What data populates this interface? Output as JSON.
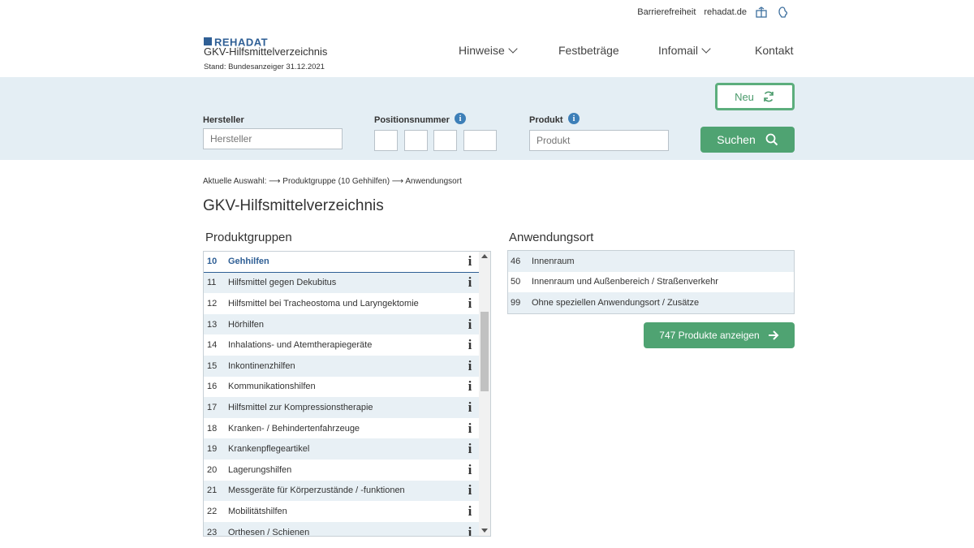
{
  "utility": {
    "accessibility": "Barrierefreiheit",
    "site": "rehadat.de",
    "icon1": "sign-language-icon",
    "icon2": "easy-language-icon"
  },
  "logo": {
    "brand": "REHADAT",
    "title": "GKV-Hilfsmittelverzeichnis",
    "stand": "Stand: Bundesanzeiger 31.12.2021"
  },
  "nav": [
    {
      "label": "Hinweise",
      "dropdown": true
    },
    {
      "label": "Festbeträge",
      "dropdown": false
    },
    {
      "label": "Infomail",
      "dropdown": true
    },
    {
      "label": "Kontakt",
      "dropdown": false
    }
  ],
  "search": {
    "hersteller_label": "Hersteller",
    "hersteller_placeholder": "Hersteller",
    "position_label": "Positionsnummer",
    "produkt_label": "Produkt",
    "produkt_placeholder": "Produkt",
    "neu_label": "Neu",
    "suchen_label": "Suchen"
  },
  "breadcrumb": "Aktuelle Auswahl: ⟶ Produktgruppe (10 Gehhilfen) ⟶ Anwendungsort",
  "page_title": "GKV-Hilfsmittelverzeichnis",
  "produktgruppen": {
    "heading": "Produktgruppen",
    "items": [
      {
        "num": "10",
        "label": "Gehhilfen",
        "selected": true
      },
      {
        "num": "11",
        "label": "Hilfsmittel gegen Dekubitus"
      },
      {
        "num": "12",
        "label": "Hilfsmittel bei Tracheostoma und Laryngektomie"
      },
      {
        "num": "13",
        "label": "Hörhilfen"
      },
      {
        "num": "14",
        "label": "Inhalations- und Atemtherapiegeräte"
      },
      {
        "num": "15",
        "label": "Inkontinenzhilfen"
      },
      {
        "num": "16",
        "label": "Kommunikationshilfen"
      },
      {
        "num": "17",
        "label": "Hilfsmittel zur Kompressionstherapie"
      },
      {
        "num": "18",
        "label": "Kranken- / Behindertenfahrzeuge"
      },
      {
        "num": "19",
        "label": "Krankenpflegeartikel"
      },
      {
        "num": "20",
        "label": "Lagerungshilfen"
      },
      {
        "num": "21",
        "label": "Messgeräte für Körperzustände / -funktionen"
      },
      {
        "num": "22",
        "label": "Mobilitätshilfen"
      },
      {
        "num": "23",
        "label": "Orthesen / Schienen"
      }
    ]
  },
  "anwendungsort": {
    "heading": "Anwendungsort",
    "items": [
      {
        "num": "46",
        "label": "Innenraum"
      },
      {
        "num": "50",
        "label": "Innenraum und Außenbereich / Straßenverkehr"
      },
      {
        "num": "99",
        "label": "Ohne speziellen Anwendungsort / Zusätze"
      }
    ],
    "button_label": "747 Produkte anzeigen"
  },
  "colors": {
    "brand_blue": "#2f5f95",
    "band": "#e4eef4",
    "green": "#4fa372",
    "info_blue": "#3d7fb8"
  }
}
